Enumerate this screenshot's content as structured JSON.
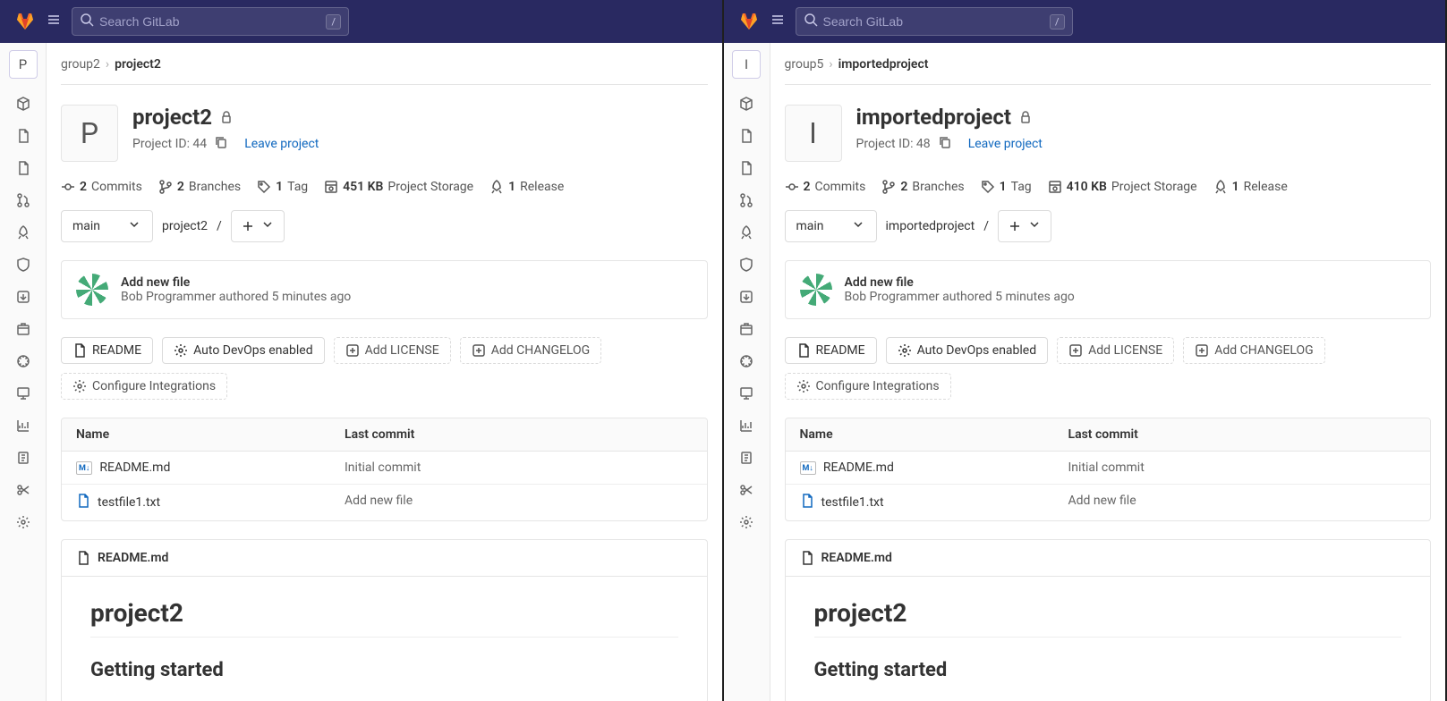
{
  "search": {
    "placeholder": "Search GitLab",
    "shortcut": "/"
  },
  "panes": [
    {
      "project_letter": "P",
      "breadcrumb": {
        "group": "group2",
        "project": "project2"
      },
      "title": "project2",
      "project_id_label": "Project ID: 44",
      "leave_label": "Leave project",
      "stats": {
        "commits": "2",
        "commits_label": "Commits",
        "branches": "2",
        "branches_label": "Branches",
        "tags": "1",
        "tags_label": "Tag",
        "storage": "451 KB",
        "storage_label": "Project Storage",
        "releases": "1",
        "releases_label": "Release"
      },
      "branch_selected": "main",
      "path": "project2",
      "latest_commit": {
        "message": "Add new file",
        "author": "Bob Programmer",
        "action": "authored",
        "time": "5 minutes ago"
      },
      "chips": {
        "readme": "README",
        "autodevops": "Auto DevOps enabled",
        "add_license": "Add LICENSE",
        "add_changelog": "Add CHANGELOG",
        "configure": "Configure Integrations"
      },
      "table": {
        "name_header": "Name",
        "commit_header": "Last commit",
        "rows": [
          {
            "name": "README.md",
            "commit": "Initial commit",
            "icon": "md"
          },
          {
            "name": "testfile1.txt",
            "commit": "Add new file",
            "icon": "txt"
          }
        ]
      },
      "readme": {
        "filename": "README.md",
        "h1": "project2",
        "h2": "Getting started"
      }
    },
    {
      "project_letter": "I",
      "breadcrumb": {
        "group": "group5",
        "project": "importedproject"
      },
      "title": "importedproject",
      "project_id_label": "Project ID: 48",
      "leave_label": "Leave project",
      "stats": {
        "commits": "2",
        "commits_label": "Commits",
        "branches": "2",
        "branches_label": "Branches",
        "tags": "1",
        "tags_label": "Tag",
        "storage": "410 KB",
        "storage_label": "Project Storage",
        "releases": "1",
        "releases_label": "Release"
      },
      "branch_selected": "main",
      "path": "importedproject",
      "latest_commit": {
        "message": "Add new file",
        "author": "Bob Programmer",
        "action": "authored",
        "time": "5 minutes ago"
      },
      "chips": {
        "readme": "README",
        "autodevops": "Auto DevOps enabled",
        "add_license": "Add LICENSE",
        "add_changelog": "Add CHANGELOG",
        "configure": "Configure Integrations"
      },
      "table": {
        "name_header": "Name",
        "commit_header": "Last commit",
        "rows": [
          {
            "name": "README.md",
            "commit": "Initial commit",
            "icon": "md"
          },
          {
            "name": "testfile1.txt",
            "commit": "Add new file",
            "icon": "txt"
          }
        ]
      },
      "readme": {
        "filename": "README.md",
        "h1": "project2",
        "h2": "Getting started"
      }
    }
  ]
}
